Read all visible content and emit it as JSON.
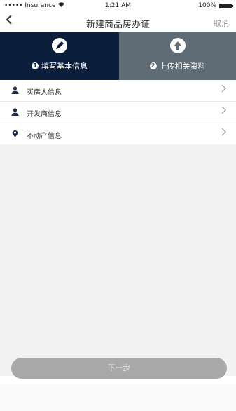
{
  "status_bar": {
    "carrier": "••••• Insurance",
    "time": "1:21 AM",
    "battery": "100%"
  },
  "nav": {
    "title": "新建商品房办证",
    "cancel": "取消"
  },
  "steps": [
    {
      "number": "1",
      "label": "填写基本信息",
      "icon": "pen-icon",
      "color": "#0b1f3c"
    },
    {
      "number": "2",
      "label": "上传相关资料",
      "icon": "upload-icon",
      "color": "#5f6b75"
    }
  ],
  "list": {
    "items": [
      {
        "label": "买房人信息",
        "icon": "person-icon"
      },
      {
        "label": "开发商信息",
        "icon": "person-icon"
      },
      {
        "label": "不动产信息",
        "icon": "location-pin-icon"
      }
    ]
  },
  "next_button": "下一步"
}
